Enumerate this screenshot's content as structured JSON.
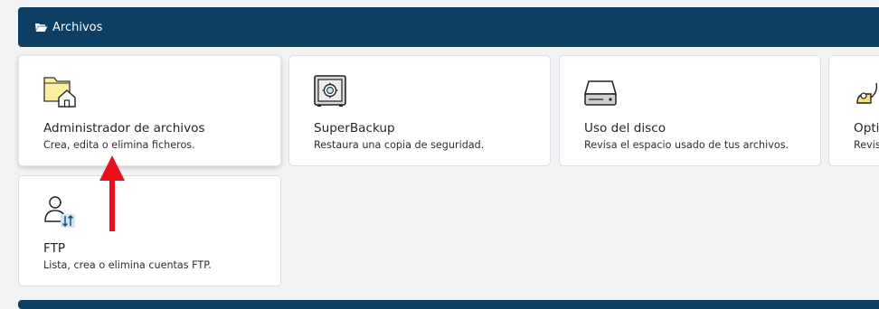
{
  "section": {
    "title": "Archivos",
    "icon": "folder-open-icon",
    "color": "#0c3f63"
  },
  "cards": [
    {
      "title": "Administrador de archivos",
      "description": "Crea, edita o elimina ficheros.",
      "icon": "folder-home-icon"
    },
    {
      "title": "SuperBackup",
      "description": "Restaura una copia de seguridad.",
      "icon": "safe-icon"
    },
    {
      "title": "Uso del disco",
      "description": "Revisa el espacio usado de tus archivos.",
      "icon": "disk-drive-icon"
    },
    {
      "title": "Opti",
      "description": "Revis",
      "icon": "vacuum-cleaner-icon"
    },
    {
      "title": "FTP",
      "description": "Lista, crea o elimina cuentas FTP.",
      "icon": "ftp-user-transfer-icon"
    }
  ],
  "annotation": {
    "type": "arrow",
    "color": "#e8101a",
    "points_to": "Administrador de archivos"
  }
}
